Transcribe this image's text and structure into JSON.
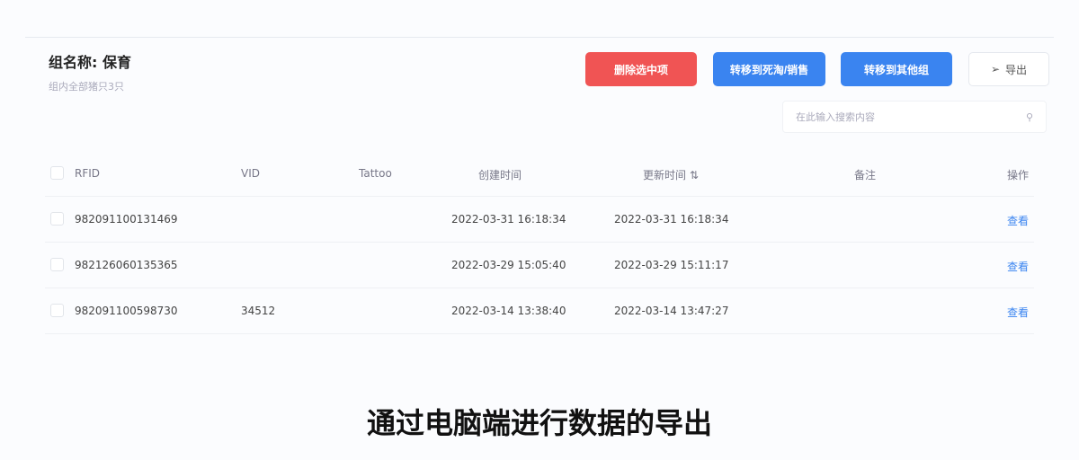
{
  "group": {
    "title": "组名称: 保育",
    "subtitle": "组内全部猪只3只"
  },
  "buttons": {
    "delete": "删除选中项",
    "transfer_dead": "转移到死淘/销售",
    "transfer_group": "转移到其他组",
    "export": "导出"
  },
  "search": {
    "placeholder": "在此输入搜索内容"
  },
  "table": {
    "headers": [
      "RFID",
      "VID",
      "Tattoo",
      "创建时间",
      "更新时间 ⇅",
      "备注",
      "操作"
    ],
    "rows": [
      {
        "rfid": "982091100131469",
        "vid": "",
        "tattoo": "",
        "created": "2022-03-31 16:18:34",
        "updated": "2022-03-31 16:18:34",
        "note": "",
        "action": "查看"
      },
      {
        "rfid": "982126060135365",
        "vid": "",
        "tattoo": "",
        "created": "2022-03-29 15:05:40",
        "updated": "2022-03-29 15:11:17",
        "note": "",
        "action": "查看"
      },
      {
        "rfid": "982091100598730",
        "vid": "34512",
        "tattoo": "",
        "created": "2022-03-14 13:38:40",
        "updated": "2022-03-14 13:47:27",
        "note": "",
        "action": "查看"
      }
    ]
  },
  "caption": "通过电脑端进行数据的导出"
}
